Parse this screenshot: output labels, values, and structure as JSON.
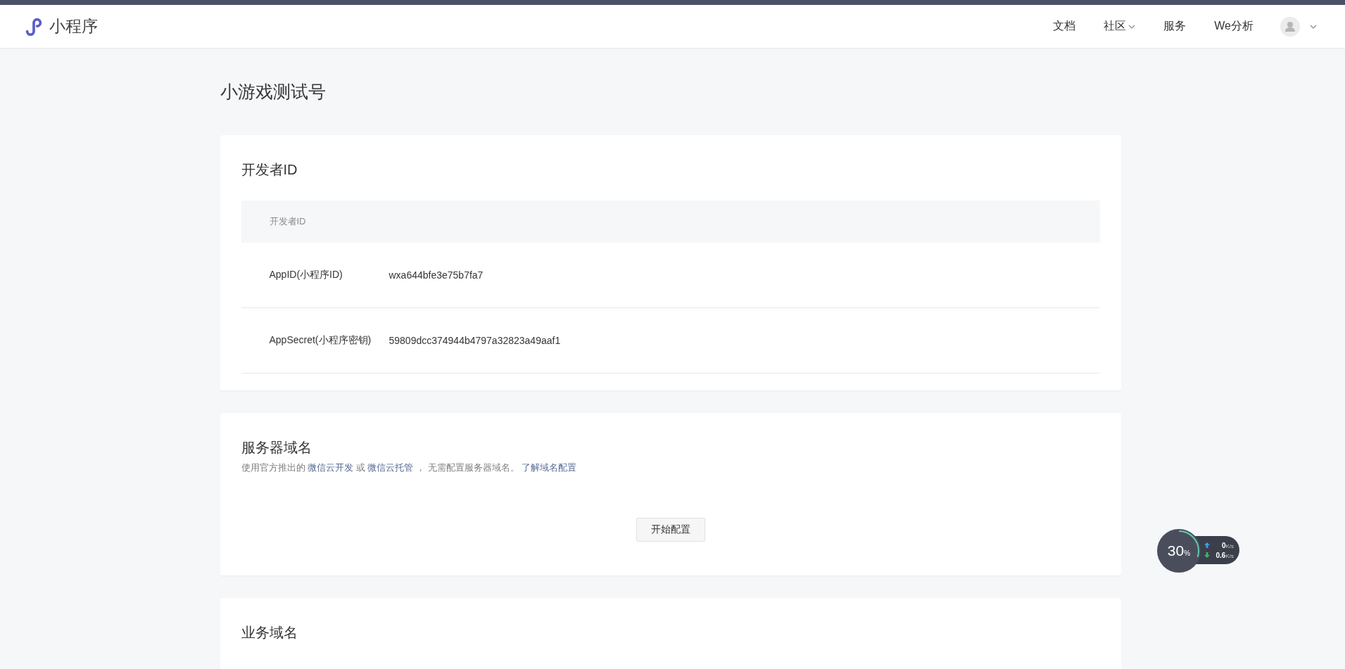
{
  "header": {
    "logo_text": "小程序",
    "nav": [
      {
        "label": "文档",
        "dropdown": false
      },
      {
        "label": "社区",
        "dropdown": true
      },
      {
        "label": "服务",
        "dropdown": false
      },
      {
        "label": "We分析",
        "dropdown": false
      }
    ],
    "account": {
      "dropdown": true
    }
  },
  "page_title": "小游戏测试号",
  "developer_id": {
    "title": "开发者ID",
    "table_header": "开发者ID",
    "rows": [
      {
        "label": "AppID(小程序ID)",
        "value": "wxa644bfe3e75b7fa7"
      },
      {
        "label": "AppSecret(小程序密钥)",
        "value": "59809dcc374944b4797a32823a49aaf1"
      }
    ]
  },
  "server_domain": {
    "title": "服务器域名",
    "description": [
      {
        "kind": "text",
        "text": "使用官方推出的"
      },
      {
        "kind": "link",
        "text": "微信云开发"
      },
      {
        "kind": "text",
        "text": "或"
      },
      {
        "kind": "link",
        "text": "微信云托管"
      },
      {
        "kind": "text",
        "text": "， 无需配置服务器域名。"
      },
      {
        "kind": "link",
        "text": "了解域名配置"
      }
    ],
    "button": "开始配置"
  },
  "business_domain": {
    "title": "业务域名"
  },
  "speed_widget": {
    "percent": "30",
    "percent_unit": "%",
    "level": 0.3,
    "upload": "0",
    "upload_unit": "K/s",
    "download": "0.6",
    "download_unit": "K/s"
  }
}
